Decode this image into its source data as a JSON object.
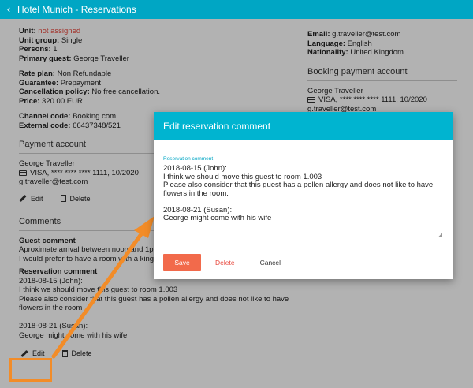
{
  "appbar": {
    "title": "Hotel Munich - Reservations",
    "back_icon": "chevron-left-icon"
  },
  "reservation": {
    "unit_label": "Unit:",
    "unit_value": "not assigned",
    "unit_group_label": "Unit group:",
    "unit_group_value": "Single",
    "persons_label": "Persons:",
    "persons_value": "1",
    "primary_guest_label": "Primary guest:",
    "primary_guest_value": "George Traveller",
    "rate_plan_label": "Rate plan:",
    "rate_plan_value": "Non Refundable",
    "guarantee_label": "Guarantee:",
    "guarantee_value": "Prepayment",
    "cancellation_label": "Cancellation policy:",
    "cancellation_value": "No free cancellation.",
    "price_label": "Price:",
    "price_value": "320.00 EUR",
    "channel_label": "Channel code:",
    "channel_value": "Booking.com",
    "external_label": "External code:",
    "external_value": "66437348/521"
  },
  "payment_account": {
    "title": "Payment account",
    "name": "George Traveller",
    "card": "VISA, **** **** **** 1111, 10/2020",
    "email": "g.traveller@test.com",
    "edit_label": "Edit",
    "delete_label": "Delete"
  },
  "comments": {
    "title": "Comments",
    "guest_comment_title": "Guest comment",
    "guest_comment_line1": "Aproximate arrival between noon and 1pm",
    "guest_comment_line2": "I would prefer to have a room with a king siz",
    "reservation_comment_title": "Reservation comment",
    "reservation_lines": [
      "2018-08-15 (John):",
      "I think we should move this guest to room 1.003",
      "Please also consider that this guest has a pollen allergy and does not like to have",
      "flowers in the room",
      "",
      "2018-08-21 (Susan):",
      "George might come with his wife"
    ],
    "edit_label": "Edit",
    "delete_label": "Delete"
  },
  "guest_contact": {
    "email_label": "Email:",
    "email_value": "g.traveller@test.com",
    "language_label": "Language:",
    "language_value": "English",
    "nationality_label": "Nationality:",
    "nationality_value": "United Kingdom"
  },
  "booking_payment_account": {
    "title": "Booking payment account",
    "name": "George Traveller",
    "card": "VISA, **** **** **** 1111, 10/2020",
    "email": "g.traveller@test.com"
  },
  "dialog": {
    "title": "Edit reservation comment",
    "field_label": "Reservation comment",
    "field_value": "2018-08-15 (John):\nI think we should move this guest to room 1.003\nPlease also consider that this guest has a pollen allergy and does not like to have flowers in the room.\n\n2018-08-21 (Susan):\nGeorge might come with his wife",
    "save_label": "Save",
    "delete_label": "Delete",
    "cancel_label": "Cancel"
  },
  "colors": {
    "primary": "#00a6c4",
    "dialog_header": "#00b4d0",
    "save_button": "#f26a4b",
    "delete_text": "#e8473c",
    "highlight": "#f28c28"
  }
}
